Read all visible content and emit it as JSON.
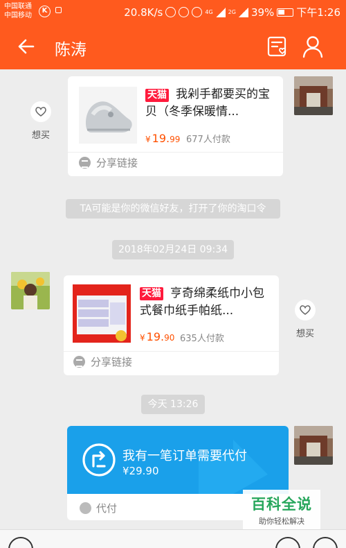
{
  "status_bar": {
    "carrier_1": "中国联通",
    "carrier_2": "中国移动",
    "k_badge": "K",
    "speed": "20.8K/s",
    "net_1": "4G",
    "net_2": "2G",
    "battery": "39%",
    "time": "下午1:26"
  },
  "header": {
    "title": "陈涛",
    "bg_color": "#ff5a1e"
  },
  "messages": {
    "item1": {
      "badge": "天猫",
      "title": "我剁手都要买的宝贝（冬季保暖情...",
      "currency": "¥",
      "price_int": "19.",
      "price_dec": "99",
      "paid": "677人付款",
      "share": "分享链接",
      "want": "想买"
    },
    "notice": "TA可能是你的微信好友，打开了你的淘口令",
    "time1": "2018年02月24日 09:34",
    "item2": {
      "badge": "天猫",
      "title": "亨奇绵柔纸巾小包式餐巾纸手帕纸...",
      "currency": "¥",
      "price_int": "19.",
      "price_dec": "90",
      "paid": "635人付款",
      "share": "分享链接",
      "want": "想买"
    },
    "time2": "今天  13:26",
    "pay": {
      "text": "我有一笔订单需要代付",
      "amount": "¥29.90",
      "label": "代付",
      "color": "#1aa0ea"
    }
  },
  "watermark": {
    "title": "百科全说",
    "subtitle": "助你轻松解决"
  }
}
